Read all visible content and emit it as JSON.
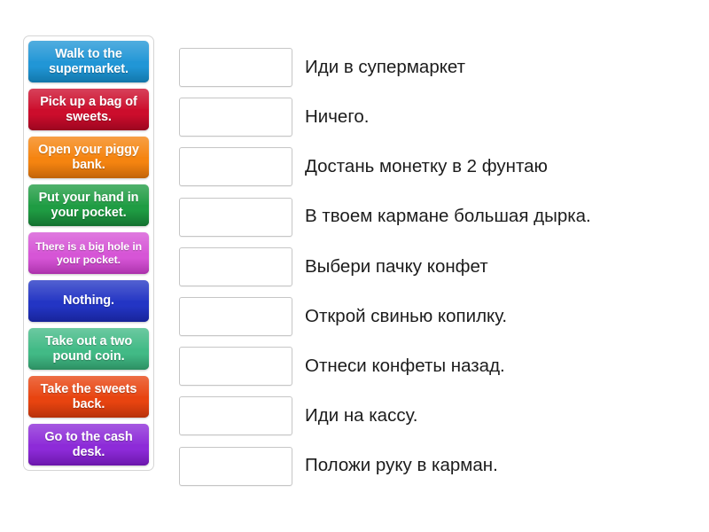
{
  "activity": {
    "type": "match-up",
    "tile_bank": {
      "tiles": [
        {
          "label": "Walk to the supermarket.",
          "color": "#2196d6",
          "color_dark": "#1277ab",
          "small": false
        },
        {
          "label": "Pick up a bag of sweets.",
          "color": "#cc0d2c",
          "color_dark": "#9c0620",
          "small": false
        },
        {
          "label": "Open your piggy bank.",
          "color": "#f58410",
          "color_dark": "#c3650a",
          "small": false
        },
        {
          "label": "Put your hand in your pocket.",
          "color": "#1f9c43",
          "color_dark": "#147230",
          "small": false
        },
        {
          "label": "There is a big hole in your pocket.",
          "color": "#d655d6",
          "color_dark": "#ad34ad",
          "small": true
        },
        {
          "label": "Nothing.",
          "color": "#2335c4",
          "color_dark": "#18249a",
          "small": false
        },
        {
          "label": "Take out a two pound coin.",
          "color": "#42ba86",
          "color_dark": "#2d9063",
          "small": false
        },
        {
          "label": "Take the sweets back.",
          "color": "#e84410",
          "color_dark": "#b8320a",
          "small": false
        },
        {
          "label": "Go to the cash desk.",
          "color": "#8d2bd8",
          "color_dark": "#6c17ad",
          "small": false
        }
      ]
    },
    "drop_zones": [
      {
        "value": "",
        "placeholder": ""
      },
      {
        "value": "",
        "placeholder": ""
      },
      {
        "value": "",
        "placeholder": ""
      },
      {
        "value": "",
        "placeholder": ""
      },
      {
        "value": "",
        "placeholder": ""
      },
      {
        "value": "",
        "placeholder": ""
      },
      {
        "value": "",
        "placeholder": ""
      },
      {
        "value": "",
        "placeholder": ""
      },
      {
        "value": "",
        "placeholder": ""
      }
    ],
    "phrases": [
      {
        "text": "Иди в супермаркет"
      },
      {
        "text": "Ничего."
      },
      {
        "text": "Достань монетку в 2 фунтаю"
      },
      {
        "text": "В твоем кармане большая дырка."
      },
      {
        "text": "Выбери пачку конфет"
      },
      {
        "text": "Открой свинью копилку."
      },
      {
        "text": "Отнеси конфеты назад."
      },
      {
        "text": "Иди на кассу."
      },
      {
        "text": "Положи руку в карман."
      }
    ]
  },
  "colors": {
    "page_background": "#ffffff",
    "bank_border": "#d5d5d5",
    "drop_zone_border": "#c6c6c6",
    "phrase_text": "#1c1c1c",
    "tile_text": "#ffffff"
  }
}
